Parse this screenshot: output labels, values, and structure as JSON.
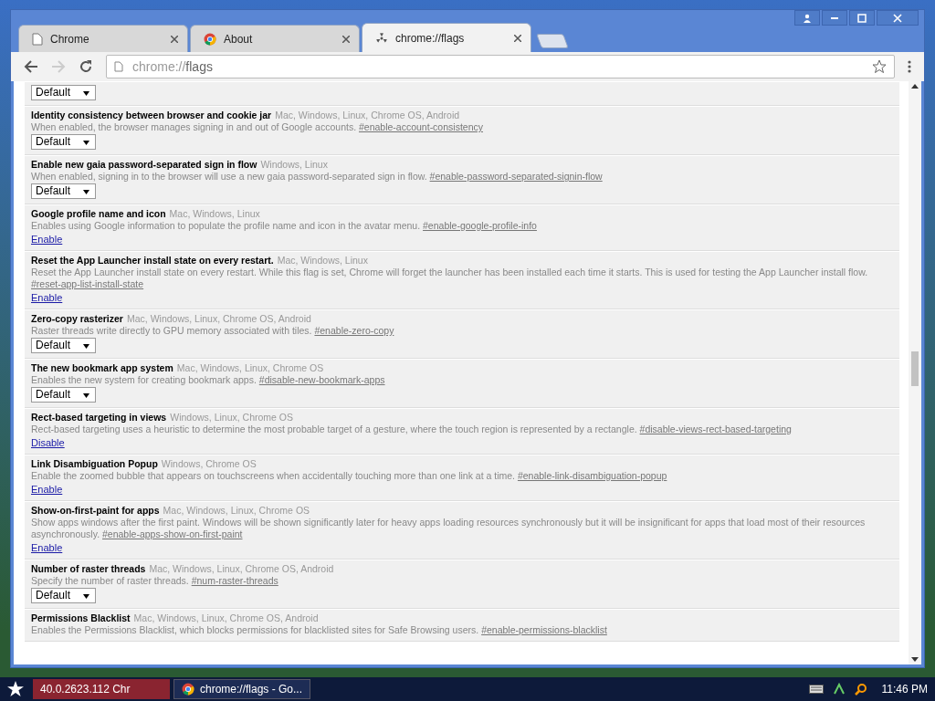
{
  "tabs": [
    {
      "title": "Chrome",
      "selected": false
    },
    {
      "title": "About",
      "selected": false
    },
    {
      "title": "chrome://flags",
      "selected": true
    }
  ],
  "address": {
    "scheme": "chrome://",
    "path": "flags"
  },
  "partial_flag": {
    "control": {
      "kind": "select",
      "value": "Default"
    }
  },
  "flags": [
    {
      "title": "Identity consistency between browser and cookie jar",
      "platforms": "Mac, Windows, Linux, Chrome OS, Android",
      "description": "When enabled, the browser manages signing in and out of Google accounts.",
      "link": "#enable-account-consistency",
      "control": {
        "kind": "select",
        "value": "Default"
      }
    },
    {
      "title": "Enable new gaia password-separated sign in flow",
      "platforms": "Windows, Linux",
      "description": "When enabled, signing in to the browser will use a new gaia password-separated sign in flow.",
      "link": "#enable-password-separated-signin-flow",
      "control": {
        "kind": "select",
        "value": "Default"
      }
    },
    {
      "title": "Google profile name and icon",
      "platforms": "Mac, Windows, Linux",
      "description": "Enables using Google information to populate the profile name and icon in the avatar menu.",
      "link": "#enable-google-profile-info",
      "control": {
        "kind": "link",
        "value": "Enable"
      }
    },
    {
      "title": "Reset the App Launcher install state on every restart.",
      "platforms": "Mac, Windows, Linux",
      "description": "Reset the App Launcher install state on every restart. While this flag is set, Chrome will forget the launcher has been installed each time it starts. This is used for testing the App Launcher install flow.",
      "link": "#reset-app-list-install-state",
      "control": {
        "kind": "link",
        "value": "Enable"
      }
    },
    {
      "title": "Zero-copy rasterizer",
      "platforms": "Mac, Windows, Linux, Chrome OS, Android",
      "description": "Raster threads write directly to GPU memory associated with tiles.",
      "link": "#enable-zero-copy",
      "control": {
        "kind": "select",
        "value": "Default"
      }
    },
    {
      "title": "The new bookmark app system",
      "platforms": "Mac, Windows, Linux, Chrome OS",
      "description": "Enables the new system for creating bookmark apps.",
      "link": "#disable-new-bookmark-apps",
      "control": {
        "kind": "select",
        "value": "Default"
      }
    },
    {
      "title": "Rect-based targeting in views",
      "platforms": "Windows, Linux, Chrome OS",
      "description": "Rect-based targeting uses a heuristic to determine the most probable target of a gesture, where the touch region is represented by a rectangle.",
      "link": "#disable-views-rect-based-targeting",
      "control": {
        "kind": "link",
        "value": "Disable"
      }
    },
    {
      "title": "Link Disambiguation Popup",
      "platforms": "Windows, Chrome OS",
      "description": "Enable the zoomed bubble that appears on touchscreens when accidentally touching more than one link at a time.",
      "link": "#enable-link-disambiguation-popup",
      "control": {
        "kind": "link",
        "value": "Enable"
      }
    },
    {
      "title": "Show-on-first-paint for apps",
      "platforms": "Mac, Windows, Linux, Chrome OS",
      "description": "Show apps windows after the first paint. Windows will be shown significantly later for heavy apps loading resources synchronously but it will be insignificant for apps that load most of their resources asynchronously.",
      "link": "#enable-apps-show-on-first-paint",
      "control": {
        "kind": "link",
        "value": "Enable"
      }
    },
    {
      "title": "Number of raster threads",
      "platforms": "Mac, Windows, Linux, Chrome OS, Android",
      "description": "Specify the number of raster threads.",
      "link": "#num-raster-threads",
      "control": {
        "kind": "select",
        "value": "Default"
      }
    },
    {
      "title": "Permissions Blacklist",
      "platforms": "Mac, Windows, Linux, Chrome OS, Android",
      "description": "Enables the Permissions Blacklist, which blocks permissions for blacklisted sites for Safe Browsing users.",
      "link": "#enable-permissions-blacklist"
    }
  ],
  "taskbar": {
    "items": [
      {
        "label": "40.0.2623.112 Chr",
        "selected": false
      },
      {
        "label": "chrome://flags - Go...",
        "selected": true
      }
    ],
    "clock": "11:46 PM"
  }
}
